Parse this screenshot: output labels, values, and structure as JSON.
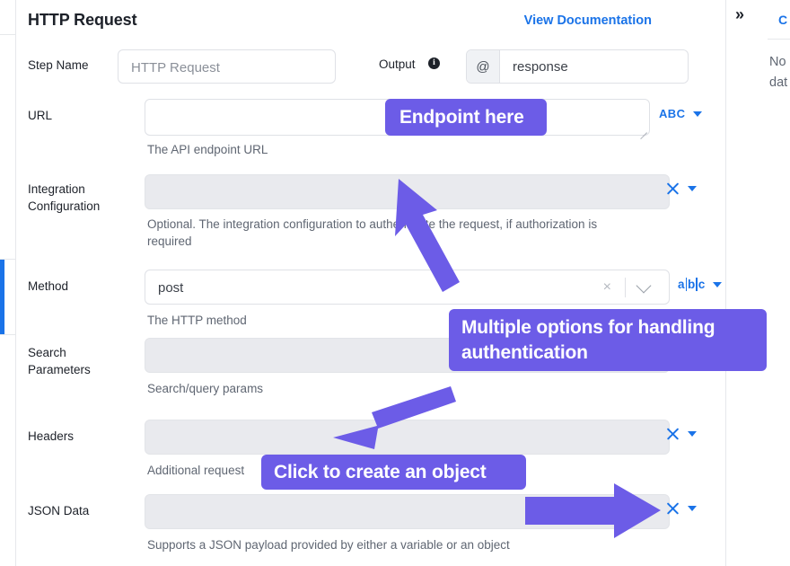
{
  "panel": {
    "title": "HTTP Request",
    "doc_link": "View Documentation"
  },
  "output": {
    "label": "Output",
    "info_icon": "info-icon",
    "prefix": "@",
    "value": "response"
  },
  "fields": [
    {
      "label": "Step Name",
      "value": "HTTP Request",
      "help": "",
      "type": "text"
    },
    {
      "label": "URL",
      "value": "",
      "help": "The API endpoint URL",
      "type": "textarea",
      "control": "ABC"
    },
    {
      "label": "Integration Configuration",
      "value": "",
      "help": "Optional. The integration configuration to authenticate the request, if authorization is required",
      "type": "disabled",
      "control": "x"
    },
    {
      "label": "Method",
      "value": "post",
      "help": "The HTTP method",
      "type": "select",
      "control": "abc"
    },
    {
      "label": "Search Parameters",
      "value": "",
      "help": "Search/query params",
      "type": "disabled",
      "control": "x"
    },
    {
      "label": "Headers",
      "value": "",
      "help": "Additional request",
      "type": "disabled",
      "control": "x"
    },
    {
      "label": "JSON Data",
      "value": "",
      "help": "Supports a JSON payload provided by either a variable or an object",
      "type": "disabled",
      "control": "x"
    }
  ],
  "labels": {
    "step_name": "Step Name",
    "url": "URL",
    "integration_configuration_l1": "Integration",
    "integration_configuration_l2": "Configuration",
    "method": "Method",
    "search_parameters_l1": "Search",
    "search_parameters_l2": "Parameters",
    "headers": "Headers",
    "json_data": "JSON Data"
  },
  "helps": {
    "url": "The API endpoint URL",
    "integration_l1": "Optional. The integration configuration to authenticate the request, if authorization is",
    "integration_l2": "required",
    "method": "The HTTP method",
    "search_parameters": "Search/query params",
    "headers": "Additional request",
    "json_data": "Supports a JSON payload provided by either a variable or an object"
  },
  "values": {
    "step_name_placeholder": "HTTP Request",
    "method": "post"
  },
  "icons": {
    "abc_upper": "ABC",
    "abc_a": "a",
    "abc_b": "b",
    "abc_c": "c",
    "select_clear": "×",
    "collapse": "»"
  },
  "right_panel": {
    "collapse_icon": "chevrons-right-icon",
    "link_partial": "C",
    "text_partial": "No\ndat"
  },
  "annotations": [
    {
      "id": "endpoint",
      "text": "Endpoint here"
    },
    {
      "id": "auth",
      "text": "Multiple options for handling authentication"
    },
    {
      "id": "object",
      "text": "Click to create an object"
    }
  ],
  "annotation_text": {
    "endpoint": "Endpoint here",
    "auth_l1": "Multiple options for handling",
    "auth_l2": "authentication",
    "object": "Click to create an object"
  },
  "colors": {
    "accent_blue": "#1a73e8",
    "annotation_purple": "#6c5ce7",
    "disabled_field": "#e9eaee",
    "text_primary": "#1d2129",
    "text_secondary": "#5f6672"
  }
}
